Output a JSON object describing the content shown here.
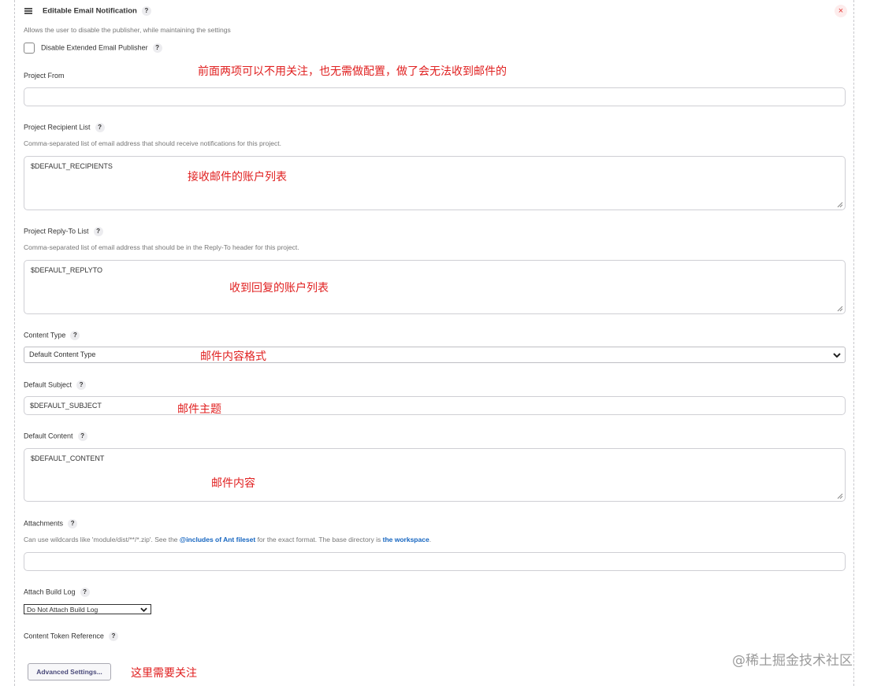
{
  "header": {
    "title": "Editable Email Notification",
    "description": "Allows the user to disable the publisher, while maintaining the settings"
  },
  "disable_publisher": {
    "label": "Disable Extended Email Publisher",
    "checked": false
  },
  "project_from": {
    "label": "Project From",
    "value": ""
  },
  "recipient_list": {
    "label": "Project Recipient List",
    "description": "Comma-separated list of email address that should receive notifications for this project.",
    "value": "$DEFAULT_RECIPIENTS"
  },
  "reply_to_list": {
    "label": "Project Reply-To List",
    "description": "Comma-separated list of email address that should be in the Reply-To header for this project.",
    "value": "$DEFAULT_REPLYTO"
  },
  "content_type": {
    "label": "Content Type",
    "selected": "Default Content Type"
  },
  "default_subject": {
    "label": "Default Subject",
    "value": "$DEFAULT_SUBJECT"
  },
  "default_content": {
    "label": "Default Content",
    "value": "$DEFAULT_CONTENT"
  },
  "attachments": {
    "label": "Attachments",
    "desc_prefix": "Can use wildcards like 'module/dist/**/*.zip'. See the ",
    "link1": "@includes of Ant fileset",
    "desc_middle": " for the exact format. The base directory is ",
    "link2": "the workspace",
    "desc_suffix": ".",
    "value": ""
  },
  "attach_build_log": {
    "label": "Attach Build Log",
    "selected": "Do Not Attach Build Log"
  },
  "content_token_reference": {
    "label": "Content Token Reference"
  },
  "advanced_button": {
    "label": "Advanced Settings..."
  },
  "annotations": {
    "top": "前面两项可以不用关注，也无需做配置，做了会无法收到邮件的",
    "recipients": "接收邮件的账户列表",
    "replyto": "收到回复的账户列表",
    "content_type": "邮件内容格式",
    "subject": "邮件主题",
    "content": "邮件内容",
    "advanced": "这里需要关注"
  },
  "help_glyph": "?",
  "close_glyph": "×",
  "watermark": "@稀土掘金技术社区",
  "colors": {
    "annotation": "#e02020",
    "link": "#1565c0",
    "close": "#e53935"
  }
}
